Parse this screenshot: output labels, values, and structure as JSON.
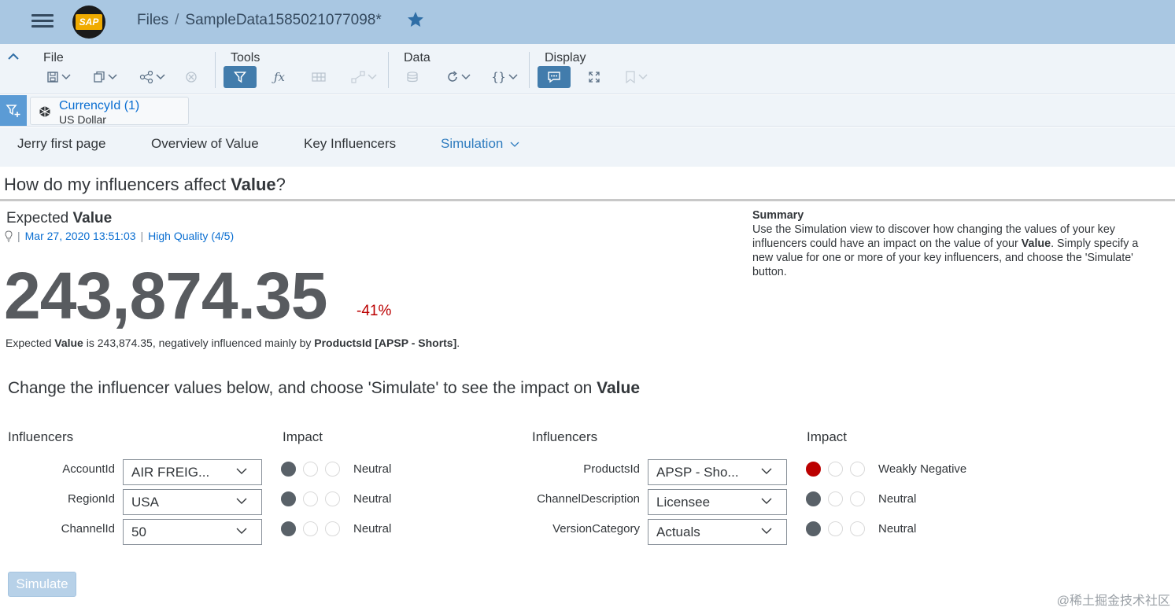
{
  "shell": {
    "crumb_root": "Files",
    "crumb_sep": "/",
    "file_name": "SampleData1585021077098*",
    "logo_text": "SAP"
  },
  "toolbar": {
    "groups": [
      "File",
      "Tools",
      "Data",
      "Display"
    ]
  },
  "filter": {
    "title": "CurrencyId (1)",
    "value": "US Dollar"
  },
  "tabs": [
    "Jerry first page",
    "Overview of Value",
    "Key Influencers",
    "Simulation"
  ],
  "question": {
    "prefix": "How do my influencers affect ",
    "measure": "Value",
    "suffix": "?"
  },
  "expected": {
    "prefix": "Expected ",
    "measure": "Value",
    "date": "Mar 27, 2020 13:51:03",
    "quality": "High Quality (4/5)",
    "value": "243,874.35",
    "delta": "-41%",
    "desc_a": "Expected ",
    "desc_b": "Value",
    "desc_c": " is 243,874.35, negatively influenced mainly by ",
    "desc_d": "ProductsId [APSP - Shorts]",
    "desc_e": "."
  },
  "summary": {
    "title": "Summary",
    "text_a": "Use the Simulation view to discover how changing the values of your key influencers could have an impact on the value of your ",
    "text_b": "Value",
    "text_c": ". Simply specify a new value for one or more of your key influencers, and choose the 'Simulate' button."
  },
  "instruction": {
    "text": "Change the influencer values below, and choose 'Simulate' to see the impact on ",
    "measure": "Value"
  },
  "headers": {
    "influencers": "Influencers",
    "impact": "Impact"
  },
  "left_rows": [
    {
      "label": "AccountId",
      "value": "AIR FREIG...",
      "impact": "Neutral",
      "level": "neutral"
    },
    {
      "label": "RegionId",
      "value": "USA",
      "impact": "Neutral",
      "level": "neutral"
    },
    {
      "label": "ChannelId",
      "value": "50",
      "impact": "Neutral",
      "level": "neutral"
    }
  ],
  "right_rows": [
    {
      "label": "ProductsId",
      "value": "APSP - Sho...",
      "impact": "Weakly Negative",
      "level": "negative"
    },
    {
      "label": "ChannelDescription",
      "value": "Licensee",
      "impact": "Neutral",
      "level": "neutral"
    },
    {
      "label": "VersionCategory",
      "value": "Actuals",
      "impact": "Neutral",
      "level": "neutral"
    }
  ],
  "simulate_label": "Simulate",
  "watermark": "@稀土掘金技术社区",
  "colors": {
    "shell_bg": "#a9c7e2",
    "accent": "#427cac",
    "link": "#0a6ed1",
    "negative": "#bb0000",
    "neutral_dot": "#596168"
  }
}
